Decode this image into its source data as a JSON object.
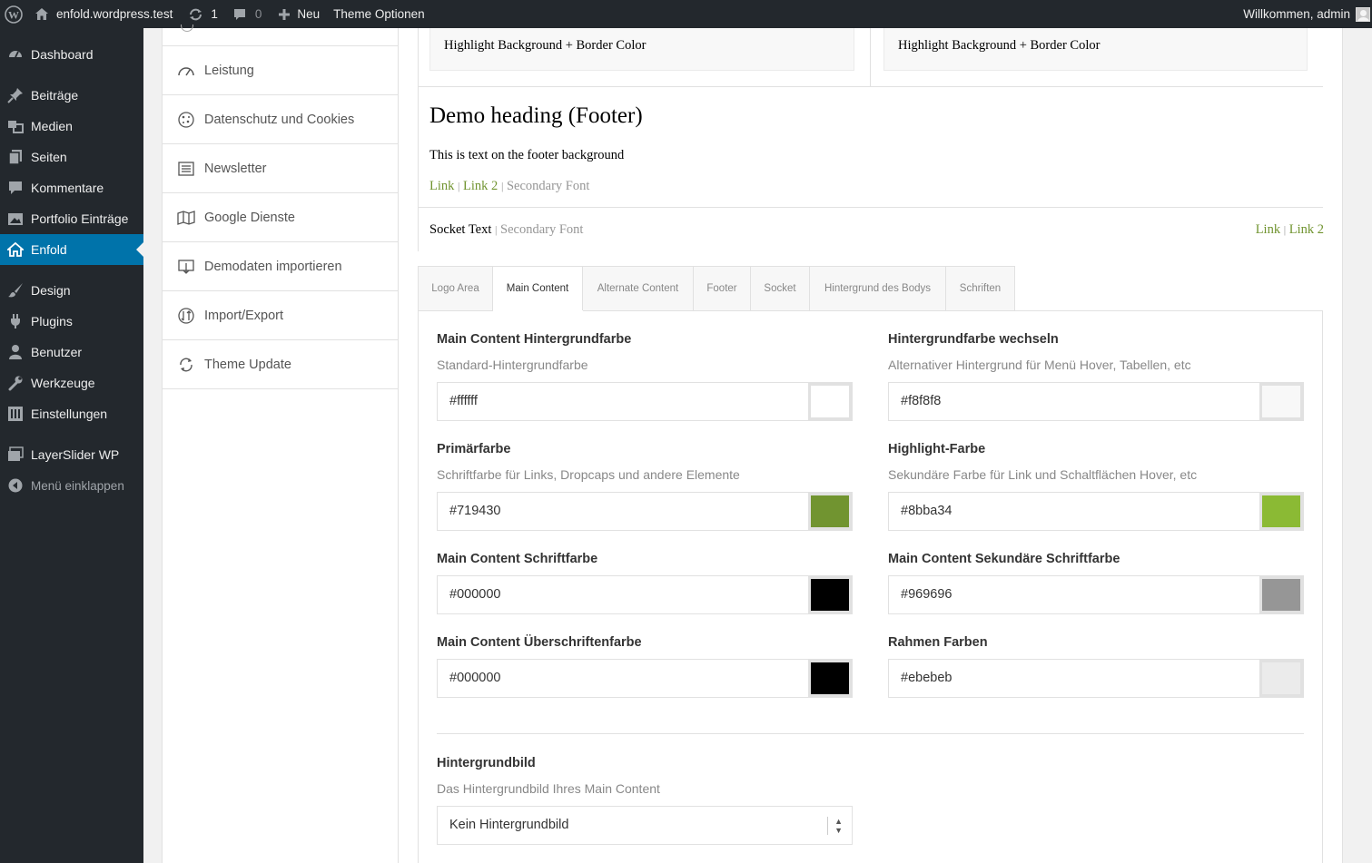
{
  "adminbar": {
    "site_name": "enfold.wordpress.test",
    "updates_count": "1",
    "comments_count": "0",
    "new_label": "Neu",
    "theme_options_label": "Theme Optionen",
    "welcome_text": "Willkommen, admin"
  },
  "sidebar": {
    "items": [
      {
        "label": "Dashboard",
        "icon": "dashboard-icon"
      },
      {
        "label": "Beiträge",
        "icon": "pin-icon"
      },
      {
        "label": "Medien",
        "icon": "media-icon"
      },
      {
        "label": "Seiten",
        "icon": "pages-icon"
      },
      {
        "label": "Kommentare",
        "icon": "comment-icon"
      },
      {
        "label": "Portfolio Einträge",
        "icon": "portfolio-icon"
      },
      {
        "label": "Enfold",
        "icon": "home-icon",
        "active": true
      },
      {
        "label": "Design",
        "icon": "brush-icon"
      },
      {
        "label": "Plugins",
        "icon": "plugin-icon"
      },
      {
        "label": "Benutzer",
        "icon": "user-icon"
      },
      {
        "label": "Werkzeuge",
        "icon": "wrench-icon"
      },
      {
        "label": "Einstellungen",
        "icon": "settings-icon"
      },
      {
        "label": "LayerSlider WP",
        "icon": "layers-icon"
      }
    ],
    "collapse_label": "Menü einklappen"
  },
  "options_nav": {
    "items": [
      {
        "label": "Leistung",
        "icon": "speedometer-icon"
      },
      {
        "label": "Datenschutz und Cookies",
        "icon": "cookie-icon"
      },
      {
        "label": "Newsletter",
        "icon": "newsletter-icon"
      },
      {
        "label": "Google Dienste",
        "icon": "map-icon"
      },
      {
        "label": "Demodaten importieren",
        "icon": "import-icon"
      },
      {
        "label": "Import/Export",
        "icon": "import-export-icon"
      },
      {
        "label": "Theme Update",
        "icon": "refresh-icon"
      }
    ]
  },
  "preview": {
    "highlight_left": "Highlight Background + Border Color",
    "highlight_right": "Highlight Background + Border Color",
    "footer_heading": "Demo heading (Footer)",
    "footer_text": "This is text on the footer background",
    "footer_link1": "Link",
    "footer_link2": "Link 2",
    "footer_secondary": "Secondary Font",
    "link_sep": "|",
    "socket_text": "Socket Text",
    "socket_secondary": "Secondary Font",
    "socket_link1": "Link",
    "socket_link2": "Link 2"
  },
  "tabs": [
    {
      "label": "Logo Area"
    },
    {
      "label": "Main Content",
      "active": true
    },
    {
      "label": "Alternate Content"
    },
    {
      "label": "Footer"
    },
    {
      "label": "Socket"
    },
    {
      "label": "Hintergrund des Bodys"
    },
    {
      "label": "Schriften"
    }
  ],
  "fields": {
    "main_bg": {
      "title": "Main Content Hintergrundfarbe",
      "desc": "Standard-Hintergrundfarbe",
      "value": "#ffffff",
      "swatch": "#ffffff"
    },
    "alt_bg": {
      "title": "Hintergrundfarbe wechseln",
      "desc": "Alternativer Hintergrund für Menü Hover, Tabellen, etc",
      "value": "#f8f8f8",
      "swatch": "#f8f8f8"
    },
    "primary": {
      "title": "Primärfarbe",
      "desc": "Schriftfarbe für Links, Dropcaps und andere Elemente",
      "value": "#719430",
      "swatch": "#719430"
    },
    "highlight": {
      "title": "Highlight-Farbe",
      "desc": "Sekundäre Farbe für Link und Schaltflächen Hover, etc",
      "value": "#8bba34",
      "swatch": "#8bba34"
    },
    "font": {
      "title": "Main Content Schriftfarbe",
      "value": "#000000",
      "swatch": "#000000"
    },
    "secondary_font": {
      "title": "Main Content Sekundäre Schriftfarbe",
      "value": "#969696",
      "swatch": "#969696"
    },
    "heading": {
      "title": "Main Content Überschriftenfarbe",
      "value": "#000000",
      "swatch": "#000000"
    },
    "border": {
      "title": "Rahmen Farben",
      "value": "#ebebeb",
      "swatch": "#ebebeb"
    },
    "bg_image": {
      "title": "Hintergrundbild",
      "desc": "Das Hintergrundbild Ihres Main Content",
      "value": "Kein Hintergrundbild"
    }
  },
  "colors": {
    "link": "#719430",
    "secondary": "#969696",
    "active_menu": "#0073aa"
  }
}
